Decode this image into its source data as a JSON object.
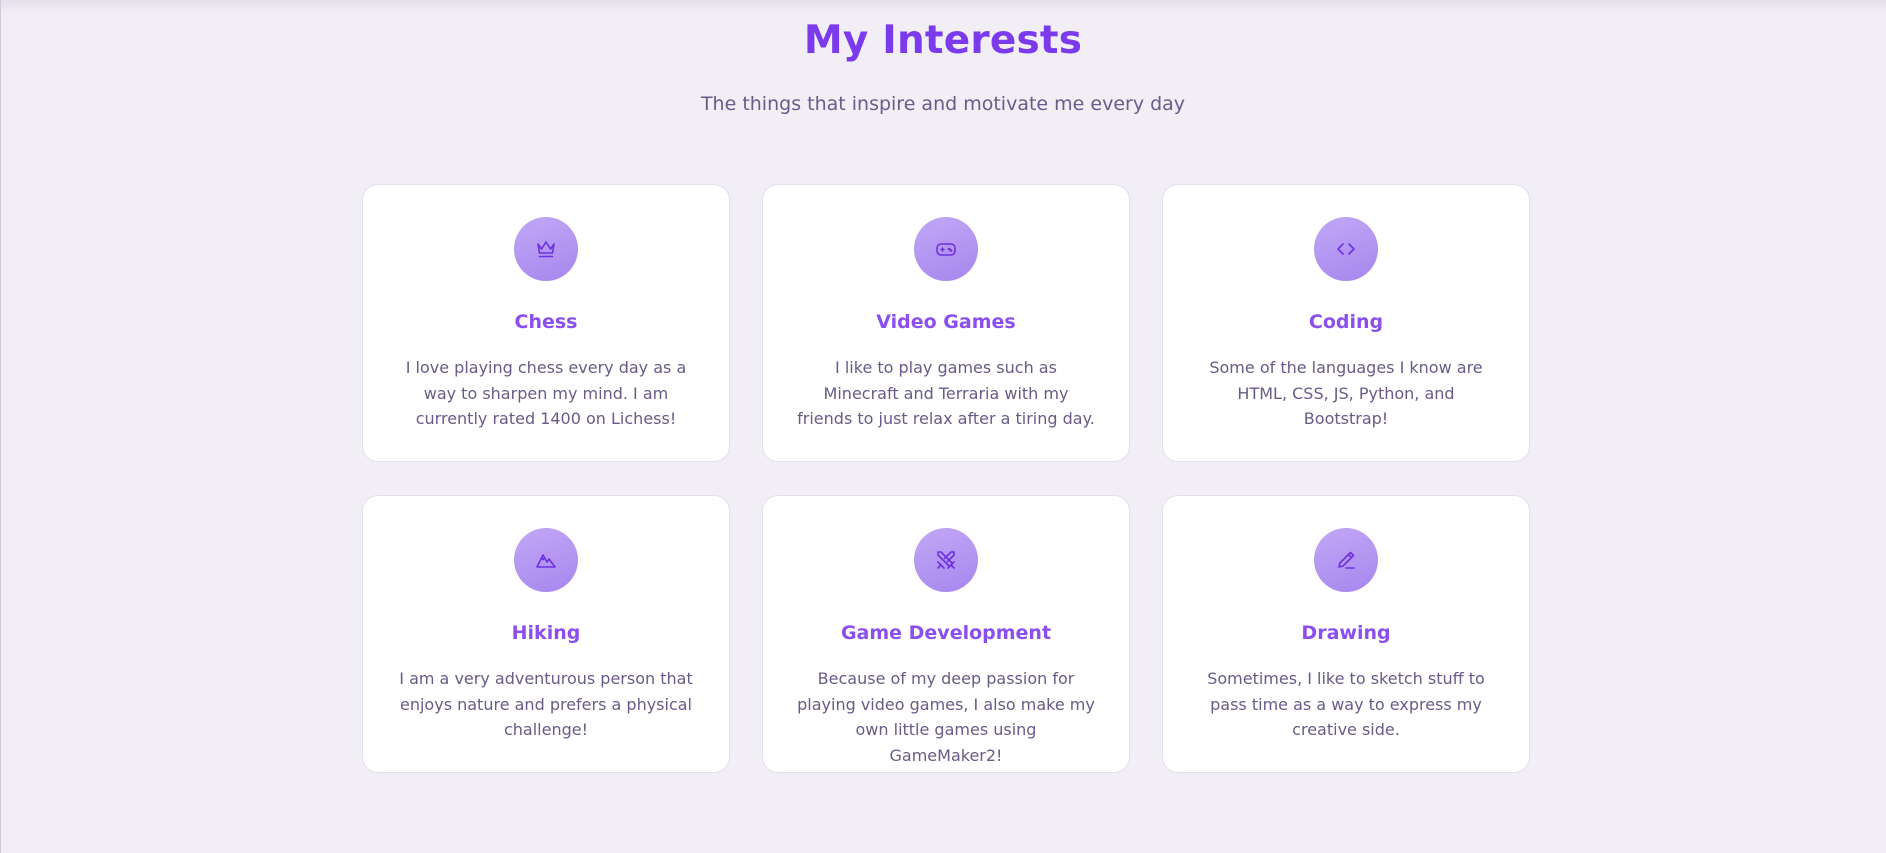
{
  "header": {
    "title": "My Interests",
    "subtitle": "The things that inspire and motivate me every day"
  },
  "colors": {
    "accent": "#7c3aed",
    "card_title": "#8b4ff0",
    "icon_bg": "#b095f2",
    "page_bg": "#f1eef6"
  },
  "interests": [
    {
      "icon": "crown-icon",
      "title": "Chess",
      "text": "I love playing chess every day as a way to sharpen my mind. I am currently rated 1400 on Lichess!"
    },
    {
      "icon": "gamepad-icon",
      "title": "Video Games",
      "text": "I like to play games such as Minecraft and Terraria with my friends to just relax after a tiring day."
    },
    {
      "icon": "code-icon",
      "title": "Coding",
      "text": "Some of the languages I know are HTML, CSS, JS, Python, and Bootstrap!"
    },
    {
      "icon": "mountain-icon",
      "title": "Hiking",
      "text": "I am a very adventurous person that enjoys nature and prefers a physical challenge!"
    },
    {
      "icon": "crossed-swords-icon",
      "title": "Game Development",
      "text": "Because of my deep passion for playing video games, I also make my own little games using GameMaker2!"
    },
    {
      "icon": "pencil-icon",
      "title": "Drawing",
      "text": "Sometimes, I like to sketch stuff to pass time as a way to express my creative side."
    }
  ]
}
